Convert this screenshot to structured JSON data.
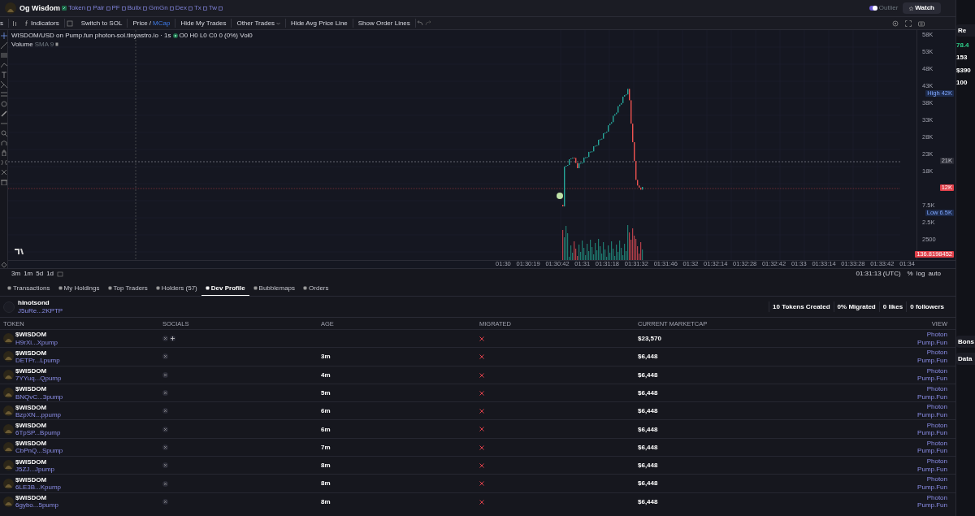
{
  "header": {
    "title": "Og Wisdom",
    "links": [
      "Token",
      "Pair",
      "PF",
      "Bullx",
      "GmGn",
      "Dex",
      "Tx",
      "Tw"
    ],
    "outlier": {
      "label": "Outlier",
      "on": true
    },
    "watch": "Watch"
  },
  "toolbar": {
    "interval": "s",
    "items": [
      {
        "kind": "indicators",
        "label": "Indicators"
      },
      {
        "kind": "plain",
        "label": "Switch to SOL"
      },
      {
        "kind": "toggle",
        "label": "Price /",
        "alt": "MCap"
      },
      {
        "kind": "plain",
        "label": "Hide My Trades"
      },
      {
        "kind": "dropdown",
        "label": "Other Trades"
      },
      {
        "kind": "plain",
        "label": "Hide Avg Price Line"
      },
      {
        "kind": "plain",
        "label": "Show Order Lines"
      }
    ]
  },
  "chart": {
    "legend": "WISDOM/USD on Pump.fun photon-sol.tinyastro.io · 1s",
    "ohlc": "O0 H0 L0 C0 0 (0%) Vol0",
    "volume": "Volume",
    "volume_sma": "SMA 9",
    "yticks": [
      "58K",
      "53K",
      "48K",
      "43K",
      "38K",
      "33K",
      "28K",
      "23K",
      "18K",
      "7.5K",
      "2.5K",
      "2500"
    ],
    "markers": [
      {
        "kind": "high",
        "label": "High",
        "value": "42K"
      },
      {
        "kind": "line",
        "value": "21K"
      },
      {
        "kind": "last",
        "value": "12K"
      },
      {
        "kind": "low",
        "label": "Low",
        "value": "6.5K"
      },
      {
        "kind": "last",
        "value": "136.8198452"
      }
    ],
    "xticks": [
      "01:30",
      "01:30:19",
      "01:30:42",
      "01:31",
      "01:31:18",
      "01:31:32",
      "01:31:46",
      "01:32",
      "01:32:14",
      "01:32:28",
      "01:32:42",
      "01:33",
      "01:33:14",
      "01:33:28",
      "01:33:42",
      "01:34"
    ],
    "ranges": [
      "3m",
      "1m",
      "5d",
      "1d"
    ],
    "time": "01:31:13 (UTC)",
    "scale": [
      "%",
      "log",
      "auto"
    ]
  },
  "tabs": [
    {
      "label": "Transactions",
      "selected": false
    },
    {
      "label": "My Holdings",
      "selected": false
    },
    {
      "label": "Top Traders",
      "selected": false
    },
    {
      "label": "Holders (57)",
      "selected": false
    },
    {
      "label": "Dev Profile",
      "selected": true
    },
    {
      "label": "Bubblemaps",
      "selected": false
    },
    {
      "label": "Orders",
      "selected": false
    }
  ],
  "dev": {
    "name": "hinotsond",
    "address": "J5uRe...2KPTP",
    "stats": [
      "10 Tokens Created",
      "0% Migrated",
      "0 likes",
      "0 followers"
    ]
  },
  "table": {
    "columns": [
      "TOKEN",
      "SOCIALS",
      "AGE",
      "MIGRATED",
      "CURRENT MARKETCAP",
      "VIEW"
    ],
    "rows": [
      {
        "name": "$WISDOM",
        "address": "H9rXi...Xpump",
        "website": true,
        "age": "",
        "migrated": false,
        "marketcap": "$23,570",
        "views": [
          "Photon",
          "Pump.Fun"
        ]
      },
      {
        "name": "$WISDOM",
        "address": "DETPr...Lpump",
        "website": false,
        "age": "3m",
        "migrated": false,
        "marketcap": "$6,448",
        "views": [
          "Photon",
          "Pump.Fun"
        ]
      },
      {
        "name": "$WISDOM",
        "address": "7YYuq...Qpump",
        "website": false,
        "age": "4m",
        "migrated": false,
        "marketcap": "$6,448",
        "views": [
          "Photon",
          "Pump.Fun"
        ]
      },
      {
        "name": "$WISDOM",
        "address": "BNQvC...3pump",
        "website": false,
        "age": "5m",
        "migrated": false,
        "marketcap": "$6,448",
        "views": [
          "Photon",
          "Pump.Fun"
        ]
      },
      {
        "name": "$WISDOM",
        "address": "BzpXN...ppump",
        "website": false,
        "age": "6m",
        "migrated": false,
        "marketcap": "$6,448",
        "views": [
          "Photon",
          "Pump.Fun"
        ]
      },
      {
        "name": "$WISDOM",
        "address": "6TpSP...Bpump",
        "website": false,
        "age": "6m",
        "migrated": false,
        "marketcap": "$6,448",
        "views": [
          "Photon",
          "Pump.Fun"
        ]
      },
      {
        "name": "$WISDOM",
        "address": "CbPnQ...Spump",
        "website": false,
        "age": "7m",
        "migrated": false,
        "marketcap": "$6,448",
        "views": [
          "Photon",
          "Pump.Fun"
        ]
      },
      {
        "name": "$WISDOM",
        "address": "J5ZJ...Jpump",
        "website": false,
        "age": "8m",
        "migrated": false,
        "marketcap": "$6,448",
        "views": [
          "Photon",
          "Pump.Fun"
        ]
      },
      {
        "name": "$WISDOM",
        "address": "6LE3B...Kpump",
        "website": false,
        "age": "8m",
        "migrated": false,
        "marketcap": "$6,448",
        "views": [
          "Photon",
          "Pump.Fun"
        ]
      },
      {
        "name": "$WISDOM",
        "address": "6gybo...5pump",
        "website": false,
        "age": "8m",
        "migrated": false,
        "marketcap": "$6,448",
        "views": [
          "Photon",
          "Pump.Fun"
        ]
      }
    ]
  },
  "side": {
    "top": "Re",
    "price": "78.4",
    "values": [
      "153",
      "$390",
      "100"
    ],
    "cards": [
      "Bons",
      "Data"
    ]
  }
}
